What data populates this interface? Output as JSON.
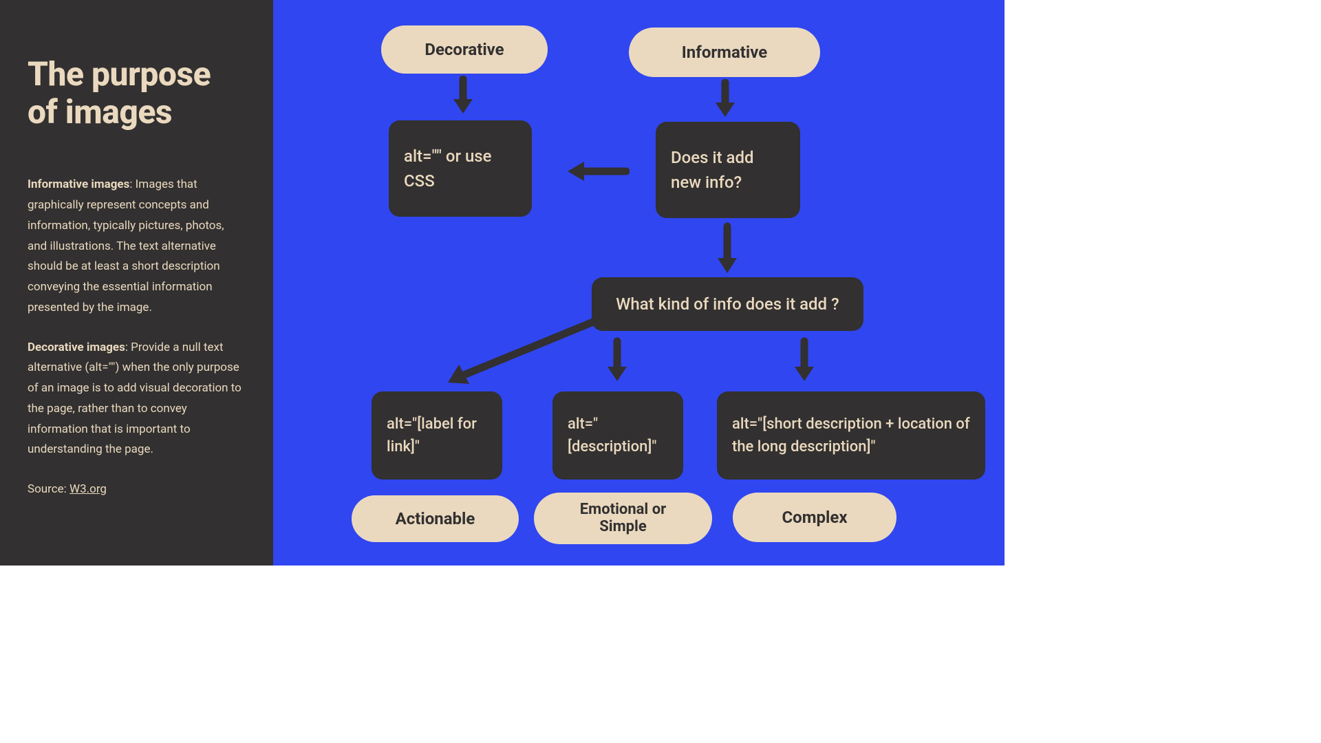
{
  "sidebar": {
    "title": "The purpose of images",
    "p1_strong": "Informative images",
    "p1_text": ": Images that graphically represent concepts and information, typically pictures, photos, and illustrations. The text alternative should be at least a short description conveying the essential information presented by the image.",
    "p2_strong": "Decorative images",
    "p2_text": ": Provide a null text alternative (alt=\"\") when the only purpose of an image is to add visual decoration to the page, rather than to convey information that is important to understanding the page.",
    "source_label": "Source: ",
    "source_link": "W3.org"
  },
  "flow": {
    "decorative_pill": "Decorative",
    "informative_pill": "Informative",
    "alt_empty": "alt=\"\" or use CSS",
    "add_info": "Does it add new info?",
    "what_kind": "What kind of info does it add ?",
    "actionable_alt": "alt=\"[label for link]\"",
    "emotional_alt": "alt=\"[description]\"",
    "complex_alt": "alt=\"[short description + location of the long description]\"",
    "actionable_pill": "Actionable",
    "emotional_pill": "Emotional or Simple",
    "complex_pill": "Complex"
  }
}
